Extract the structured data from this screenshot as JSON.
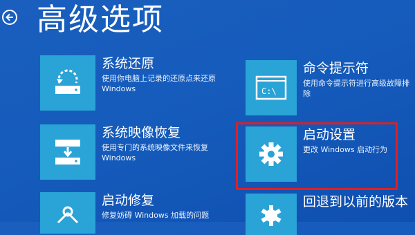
{
  "page": {
    "title": "高级选项"
  },
  "options": [
    {
      "title": "系统还原",
      "desc": "使用你电脑上记录的还原点来还原\nWindows",
      "icon": "system-restore-icon"
    },
    {
      "title": "系统映像恢复",
      "desc": "使用专门的系统映像文件来恢复\nWindows",
      "icon": "system-image-recovery-icon"
    },
    {
      "title": "启动修复",
      "desc": "修复妨碍 Windows 加载的问题",
      "icon": "startup-repair-icon"
    },
    {
      "title": "命令提示符",
      "desc": "使用命令提示符进行高级故障排除",
      "icon": "command-prompt-icon"
    },
    {
      "title": "启动设置",
      "desc": "更改 Windows 启动行为",
      "icon": "gear-icon"
    },
    {
      "title": "回退到以前的版本",
      "desc": "",
      "icon": "previous-version-icon"
    }
  ],
  "colors": {
    "background": "#155bbb",
    "tile": "#2aa3d6",
    "highlight": "#e02020"
  }
}
